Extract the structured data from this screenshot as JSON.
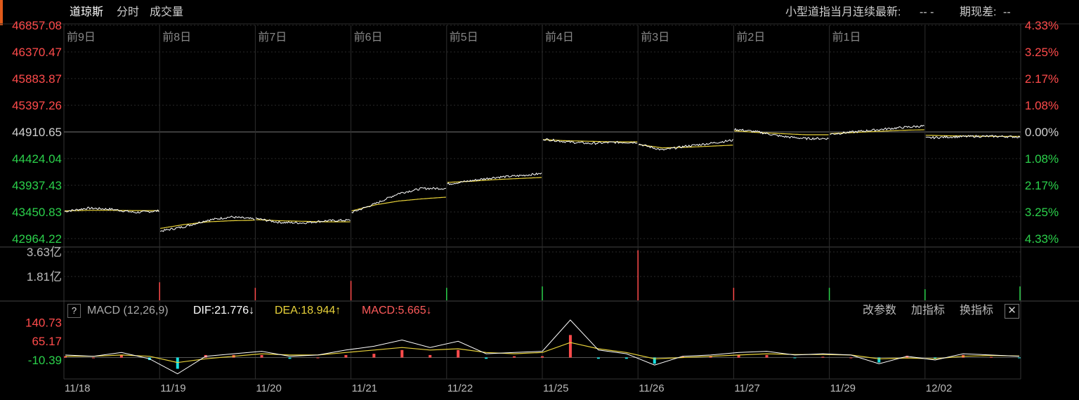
{
  "header": {
    "instrument": "道琼斯",
    "tabs": [
      "分时",
      "成交量"
    ],
    "contract_label": "小型道指当月连续最新:",
    "contract_value": "--  -",
    "spread_label": "期现差:",
    "spread_value": "--"
  },
  "colors": {
    "up": "#ff4b4b",
    "down": "#2bd14b",
    "price_line": "#ffffff",
    "avg_line": "#e8d23a",
    "neutral": "#d0d0d0",
    "cyan": "#18e0e0",
    "grid": "#2a2a2a",
    "accent": "#e05a1a"
  },
  "macd": {
    "label": "MACD (12,26,9)",
    "dif": "DIF:21.776↓",
    "dea": "DEA:18.944↑",
    "macd": "MACD:5.665↓",
    "buttons": [
      "改参数",
      "加指标",
      "换指标"
    ],
    "help": "?",
    "close": "✕"
  },
  "chart_data": [
    {
      "type": "line",
      "panel": "price",
      "reference_price": 44910.65,
      "y_ticks": [
        "46857.08",
        "46370.47",
        "45883.87",
        "45397.26",
        "44910.65",
        "44424.04",
        "43937.43",
        "43450.83",
        "42964.22"
      ],
      "pct_ticks": [
        "4.33%",
        "3.25%",
        "2.17%",
        "1.08%",
        "0.00%",
        "1.08%",
        "2.17%",
        "3.25%",
        "4.33%"
      ],
      "ylim": [
        42964.22,
        46857.08
      ],
      "day_labels": [
        "前9日",
        "前8日",
        "前7日",
        "前6日",
        "前5日",
        "前4日",
        "前3日",
        "前2日",
        "前1日"
      ],
      "dates": [
        "11/18",
        "11/19",
        "11/20",
        "11/21",
        "11/22",
        "11/25",
        "11/26",
        "11/27",
        "11/29",
        "12/02"
      ],
      "sessions": [
        {
          "date": "11/18",
          "price": [
            43460,
            43520,
            43500,
            43440,
            43470
          ],
          "avg": [
            43470,
            43480,
            43480,
            43475,
            43475
          ]
        },
        {
          "date": "11/19",
          "price": [
            43100,
            43180,
            43300,
            43360,
            43320
          ],
          "avg": [
            43150,
            43220,
            43270,
            43290,
            43300
          ]
        },
        {
          "date": "11/20",
          "price": [
            43330,
            43260,
            43250,
            43290,
            43300
          ],
          "avg": [
            43310,
            43290,
            43280,
            43270,
            43270
          ]
        },
        {
          "date": "11/21",
          "price": [
            43440,
            43600,
            43790,
            43880,
            43880
          ],
          "avg": [
            43470,
            43580,
            43650,
            43690,
            43720
          ]
        },
        {
          "date": "11/22",
          "price": [
            43960,
            44020,
            44080,
            44110,
            44150
          ],
          "avg": [
            43990,
            44010,
            44040,
            44060,
            44080
          ]
        },
        {
          "date": "11/25",
          "price": [
            44780,
            44730,
            44700,
            44720,
            44720
          ],
          "avg": [
            44770,
            44750,
            44740,
            44730,
            44730
          ]
        },
        {
          "date": "11/26",
          "price": [
            44690,
            44580,
            44650,
            44700,
            44760
          ],
          "avg": [
            44680,
            44620,
            44630,
            44650,
            44670
          ]
        },
        {
          "date": "11/27",
          "price": [
            44960,
            44910,
            44830,
            44790,
            44790
          ],
          "avg": [
            44930,
            44900,
            44880,
            44860,
            44860
          ]
        },
        {
          "date": "11/29",
          "price": [
            44870,
            44910,
            44950,
            44990,
            45020
          ],
          "avg": [
            44880,
            44900,
            44920,
            44940,
            44950
          ]
        },
        {
          "date": "12/02",
          "price": [
            44800,
            44820,
            44830,
            44830,
            44820
          ],
          "avg": [
            44850,
            44840,
            44835,
            44830,
            44830
          ]
        }
      ]
    },
    {
      "type": "bar",
      "panel": "volume",
      "y_ticks": [
        "3.63亿",
        "1.81亿"
      ],
      "ylim": [
        0,
        3.63
      ],
      "unit": "亿",
      "spikes": [
        {
          "date": "11/19",
          "value": 1.3,
          "color": "up"
        },
        {
          "date": "11/20",
          "value": 0.9,
          "color": "up"
        },
        {
          "date": "11/21",
          "value": 1.4,
          "color": "up"
        },
        {
          "date": "11/22",
          "value": 0.9,
          "color": "down"
        },
        {
          "date": "11/25",
          "value": 1.0,
          "color": "down"
        },
        {
          "date": "11/26",
          "value": 3.6,
          "color": "up"
        },
        {
          "date": "11/27",
          "value": 0.9,
          "color": "up"
        },
        {
          "date": "11/29",
          "value": 0.9,
          "color": "down"
        },
        {
          "date": "12/02",
          "value": 0.8,
          "color": "down"
        },
        {
          "date": "end",
          "value": 1.0,
          "color": "down"
        }
      ]
    },
    {
      "type": "line",
      "panel": "macd",
      "y_ticks": [
        "140.73",
        "65.17",
        "-10.39"
      ],
      "ylim": [
        -80,
        150
      ],
      "series": [
        {
          "name": "DIF",
          "values": [
            10,
            5,
            20,
            -5,
            -65,
            5,
            15,
            25,
            5,
            10,
            30,
            45,
            70,
            40,
            65,
            15,
            20,
            25,
            150,
            30,
            15,
            -30,
            5,
            10,
            20,
            25,
            10,
            15,
            10,
            -25,
            5,
            -10,
            15,
            10,
            5
          ]
        },
        {
          "name": "DEA",
          "values": [
            5,
            5,
            10,
            5,
            -20,
            -5,
            5,
            15,
            10,
            10,
            20,
            30,
            40,
            30,
            35,
            20,
            15,
            20,
            60,
            35,
            20,
            -5,
            0,
            5,
            10,
            15,
            12,
            12,
            10,
            -5,
            -2,
            -5,
            5,
            8,
            6
          ]
        }
      ]
    }
  ]
}
